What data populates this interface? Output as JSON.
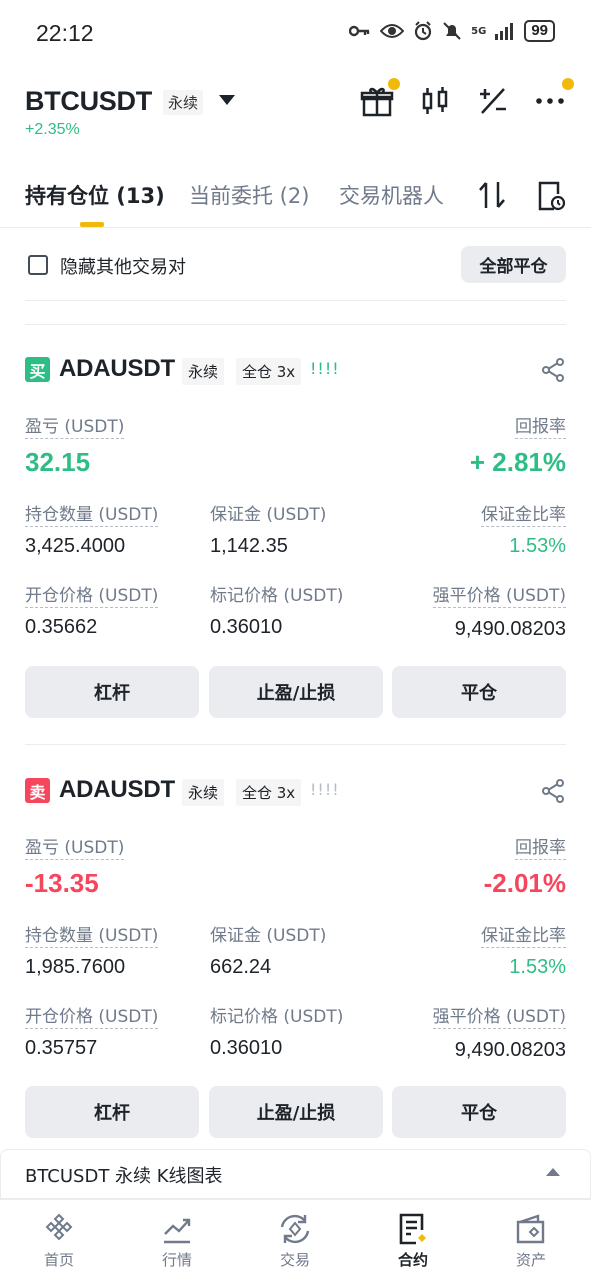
{
  "status_bar": {
    "time": "22:12",
    "battery": "99",
    "network": "5G"
  },
  "header": {
    "pair": "BTCUSDT",
    "contract_type": "永续",
    "change": "+2.35%"
  },
  "tabs": [
    {
      "label": "持有仓位 (13)"
    },
    {
      "label": "当前委托 (2)"
    },
    {
      "label": "交易机器人"
    }
  ],
  "filters": {
    "hide_other_pairs": "隐藏其他交易对",
    "close_all": "全部平仓"
  },
  "positions": [
    {
      "side_label": "买",
      "symbol": "ADAUSDT",
      "contract": "永续",
      "margin_mode": "全仓 3x",
      "bars": "!!!!",
      "pnl_label": "盈亏 (USDT)",
      "pnl": "32.15",
      "roe_label": "回报率",
      "roe": "+ 2.81%",
      "size_label": "持仓数量 (USDT)",
      "size": "3,425.4000",
      "margin_label": "保证金 (USDT)",
      "margin": "1,142.35",
      "margin_ratio_label": "保证金比率",
      "margin_ratio": "1.53%",
      "entry_label": "开仓价格 (USDT)",
      "entry": "0.35662",
      "mark_label": "标记价格 (USDT)",
      "mark": "0.36010",
      "liq_label": "强平价格 (USDT)",
      "liq": "9,490.08203",
      "btn_leverage": "杠杆",
      "btn_tpsl": "止盈/止损",
      "btn_close": "平仓"
    },
    {
      "side_label": "卖",
      "symbol": "ADAUSDT",
      "contract": "永续",
      "margin_mode": "全仓 3x",
      "bars": "!!!!",
      "pnl_label": "盈亏 (USDT)",
      "pnl": "-13.35",
      "roe_label": "回报率",
      "roe": "-2.01%",
      "size_label": "持仓数量 (USDT)",
      "size": "1,985.7600",
      "margin_label": "保证金 (USDT)",
      "margin": "662.24",
      "margin_ratio_label": "保证金比率",
      "margin_ratio": "1.53%",
      "entry_label": "开仓价格 (USDT)",
      "entry": "0.35757",
      "mark_label": "标记价格 (USDT)",
      "mark": "0.36010",
      "liq_label": "强平价格 (USDT)",
      "liq": "9,490.08203",
      "btn_leverage": "杠杆",
      "btn_tpsl": "止盈/止损",
      "btn_close": "平仓"
    }
  ],
  "chart_panel": {
    "label": "BTCUSDT 永续 K线图表"
  },
  "bottom_nav": [
    {
      "label": "首页",
      "icon": "home-icon"
    },
    {
      "label": "行情",
      "icon": "markets-icon"
    },
    {
      "label": "交易",
      "icon": "trade-icon"
    },
    {
      "label": "合约",
      "icon": "futures-icon",
      "active": true
    },
    {
      "label": "资产",
      "icon": "wallet-icon"
    }
  ],
  "colors": {
    "accent": "#f0b90b",
    "up": "#2ebd85",
    "down": "#f6465d"
  }
}
